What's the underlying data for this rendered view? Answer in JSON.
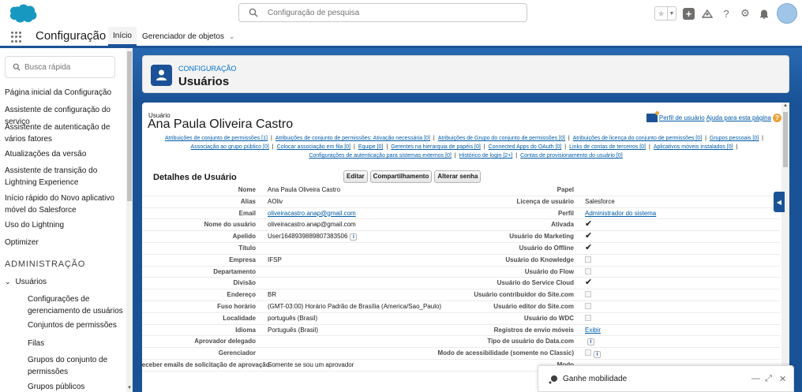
{
  "header": {
    "search_placeholder": "Configuração de pesquisa"
  },
  "appnav": {
    "app_name": "Configuração",
    "tabs": [
      {
        "label": "Início",
        "active": true
      },
      {
        "label": "Gerenciador de objetos"
      }
    ]
  },
  "sidebar": {
    "search_placeholder": "Busca rápida",
    "items": [
      "Página inicial da Configuração",
      "Assistente de configuração do serviço",
      "Assistente de autenticação de vários fatores",
      "Atualizações da versão",
      "Assistente de transição do Lightning Experience",
      "Início rápido do Novo aplicativo móvel do Salesforce",
      "Uso do Lightning",
      "Optimizer"
    ],
    "section_title": "ADMINISTRAÇÃO",
    "group_label": "Usuários",
    "sub_items": [
      "Configurações de gerenciamento de usuários",
      "Conjuntos de permissões",
      "Filas",
      "Grupos do conjunto de permissões",
      "Grupos públicos"
    ]
  },
  "page_header": {
    "eyebrow": "CONFIGURAÇÃO",
    "title": "Usuários"
  },
  "user": {
    "kicker": "Usuário",
    "name": "Ana Paula Oliveira Castro",
    "profile_link": "Perfil de usuário",
    "help_link": "Ajuda para esta página",
    "related_links": [
      "Atribuições de conjunto de permissões [1]",
      "Atribuições de conjunto de permissões: Ativação necessária [0]",
      "Atribuições de Grupo do conjunto de permissões [0]",
      "Atribuições de licença do conjunto de permissões [0]",
      "Grupos pessoais [0]",
      "Associação ao grupo público [0]",
      "Colocar associação em fila [0]",
      "Equipe [0]",
      "Gerentes na hierarquia de papéis [0]",
      "Connected Apps do OAuth [0]",
      "Links de contas de terceiros [0]",
      "Aplicativos móveis instalados [0]",
      "Configurações de autenticação para sistemas externos [0]",
      "Histórico de login [2+]",
      "Contas de provisionamento do usuário [0]"
    ]
  },
  "details": {
    "title": "Detalhes de Usuário",
    "buttons": [
      "Editar",
      "Compartilhamento",
      "Alterar senha"
    ],
    "rows": [
      {
        "l1": "Nome",
        "v1": "Ana Paula Oliveira Castro",
        "l2": "Papel",
        "v2": ""
      },
      {
        "l1": "Alias",
        "v1": "AOliv",
        "l2": "Licença de usuário",
        "v2": "Salesforce"
      },
      {
        "l1": "Email",
        "v1": "oliveiracastro.anap@gmail.com",
        "v1link": true,
        "l2": "Perfil",
        "v2": "Administrador do sistema",
        "v2link": true
      },
      {
        "l1": "Nome do usuário",
        "v1": "oliveiracastro.anap@gmail.com",
        "l2": "Ativada",
        "v2check": true
      },
      {
        "l1": "Apelido",
        "v1": "User16489398898073835​06",
        "v1info": true,
        "l2": "Usuário do Marketing",
        "v2check": true
      },
      {
        "l1": "Título",
        "v1": "",
        "l2": "Usuário do Offline",
        "v2check": true
      },
      {
        "l1": "Empresa",
        "v1": "IFSP",
        "l2": "Usuário do Knowledge",
        "v2box": true
      },
      {
        "l1": "Departamento",
        "v1": "",
        "l2": "Usuário do Flow",
        "v2box": true
      },
      {
        "l1": "Divisão",
        "v1": "",
        "l2": "Usuário do Service Cloud",
        "v2check": true
      },
      {
        "l1": "Endereço",
        "v1": "BR",
        "l2": "Usuário contribuidor do Site.com",
        "v2box": true
      },
      {
        "l1": "Fuso horário",
        "v1": "(GMT-03:00) Horário Padrão de Brasília (America/Sao_Paulo)",
        "l2": "Usuário editor do Site.com",
        "v2box": true
      },
      {
        "l1": "Localidade",
        "v1": "português (Brasil)",
        "l2": "Usuário do WDC",
        "v2box": true
      },
      {
        "l1": "Idioma",
        "v1": "Português (Brasil)",
        "l2": "Registros de envio móveis",
        "v2": "Exibir",
        "v2link": true
      },
      {
        "l1": "Aprovador delegado",
        "v1": "",
        "l2": "Tipo de usuário do Data.com",
        "v2info": true
      },
      {
        "l1": "Gerenciador",
        "v1": "",
        "l2": "Modo de acessibilidade (somente no Classic)",
        "v2box": true,
        "v2info": true
      },
      {
        "l1": "Receber emails de solicitação de aprovação",
        "v1": "Somente se sou um aprovador",
        "l2": "Modo",
        "v2": ""
      }
    ]
  },
  "mobile_bar": {
    "label": "Ganhe mobilidade"
  },
  "colors": {
    "brand": "#1b5297",
    "link": "#015ba7",
    "accent": "#0070d2"
  }
}
